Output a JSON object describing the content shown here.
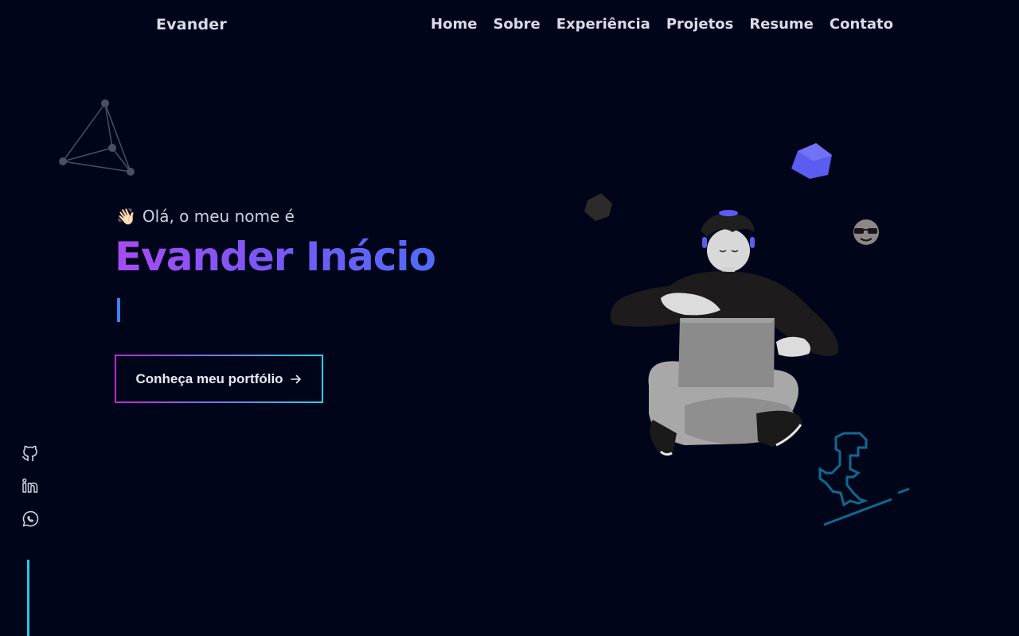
{
  "header": {
    "brand": "Evander",
    "nav": [
      {
        "label": "Home"
      },
      {
        "label": "Sobre"
      },
      {
        "label": "Experiência"
      },
      {
        "label": "Projetos"
      },
      {
        "label": "Resume"
      },
      {
        "label": "Contato"
      }
    ]
  },
  "hero": {
    "greeting_emoji": "👋🏻",
    "greeting": "Olá, o meu nome é",
    "name": "Evander Inácio",
    "cta_label": "Conheça meu portfólio",
    "cta_icon": "arrow-right-icon"
  },
  "social": {
    "icons": [
      "github-icon",
      "linkedin-icon",
      "whatsapp-icon"
    ]
  },
  "colors": {
    "background": "#01051a",
    "name_gradient_start": "#a64cf2",
    "name_gradient_end": "#4f6cf7",
    "accent_line": "#22c8ee",
    "cube": "#5b5cf0"
  }
}
